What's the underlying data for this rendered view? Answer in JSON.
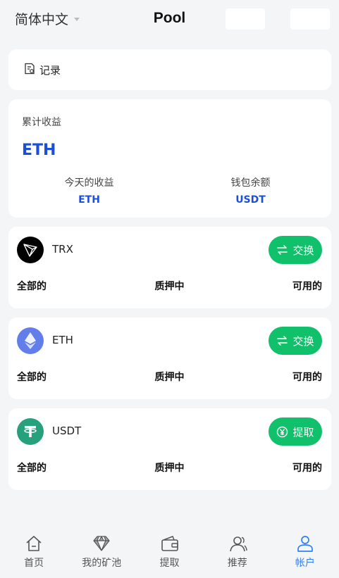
{
  "header": {
    "language": "简体中文",
    "title": "Pool"
  },
  "record": {
    "label": "记录",
    "icon": "record-icon"
  },
  "earnings": {
    "cumulative_label": "累计收益",
    "cumulative_value": "ETH",
    "today_label": "今天的收益",
    "today_value": "ETH",
    "wallet_label": "钱包余额",
    "wallet_value": "USDT"
  },
  "coins": [
    {
      "name": "TRX",
      "icon": "trx-icon",
      "action": "交换",
      "action_icon": "exchange-icon",
      "total": "全部的",
      "staking": "质押中",
      "available": "可用的",
      "color": "#000000"
    },
    {
      "name": "ETH",
      "icon": "eth-icon",
      "action": "交换",
      "action_icon": "exchange-icon",
      "total": "全部的",
      "staking": "质押中",
      "available": "可用的",
      "color": "#627eea"
    },
    {
      "name": "USDT",
      "icon": "usdt-icon",
      "action": "提取",
      "action_icon": "yen-icon",
      "total": "全部的",
      "staking": "质押中",
      "available": "可用的",
      "color": "#26a17b"
    }
  ],
  "tabs": [
    {
      "label": "首页",
      "icon": "home-icon"
    },
    {
      "label": "我的矿池",
      "icon": "diamond-icon"
    },
    {
      "label": "提取",
      "icon": "wallet-icon"
    },
    {
      "label": "推荐",
      "icon": "users-icon"
    },
    {
      "label": "帐户",
      "icon": "user-icon",
      "active": true
    }
  ],
  "colors": {
    "accent_blue": "#1b4fd8",
    "action_green": "#11c06a",
    "tab_active": "#2d7ff9"
  }
}
